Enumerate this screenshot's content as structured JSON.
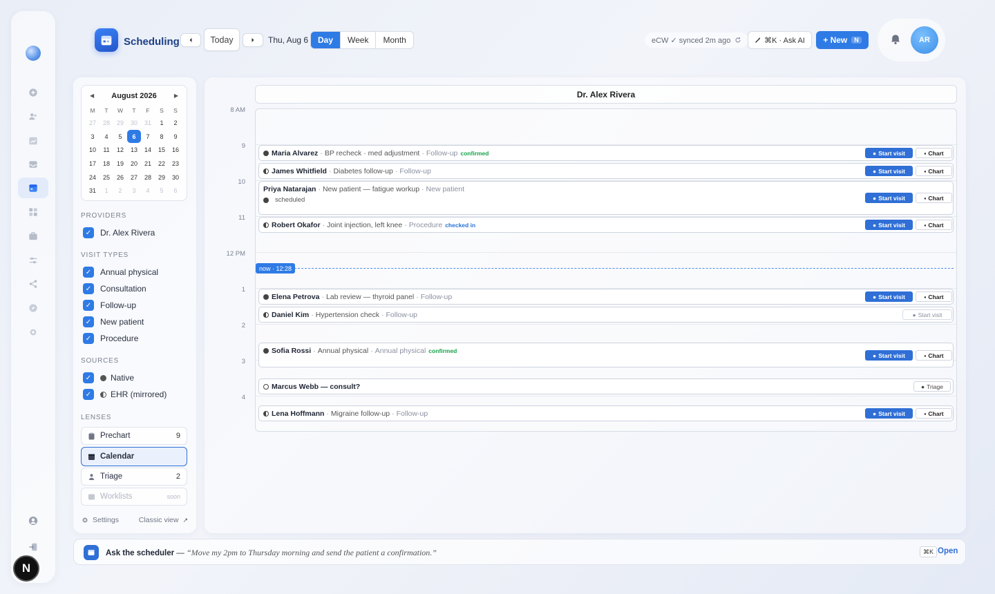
{
  "header": {
    "app_title": "Scheduling",
    "today_label": "Today",
    "date_label": "Thu, Aug 6",
    "views": [
      "Day",
      "Week",
      "Month"
    ],
    "active_view": "Day",
    "sync_status": "eCW ✓ synced 2m ago",
    "ask_ai_label": "⌘K · Ask AI",
    "new_label": "+ New",
    "new_shortcut": "N",
    "avatar_initials": "AR"
  },
  "rail": {
    "icons": [
      "plus-icon",
      "users-icon",
      "chart-icon",
      "inbox-icon",
      "calendar-icon",
      "grid-icon",
      "briefcase-icon",
      "sliders-icon",
      "share-icon",
      "compass-icon",
      "settings-icon",
      "user-icon",
      "logout-icon"
    ],
    "active": "calendar-icon",
    "badge": "N"
  },
  "mini_calendar": {
    "month_label": "August 2026",
    "weekdays": [
      "M",
      "T",
      "W",
      "T",
      "F",
      "S",
      "S"
    ],
    "weeks": [
      [
        "27",
        "28",
        "29",
        "30",
        "31",
        "1",
        "2"
      ],
      [
        "3",
        "4",
        "5",
        "6",
        "7",
        "8",
        "9"
      ],
      [
        "10",
        "11",
        "12",
        "13",
        "14",
        "15",
        "16"
      ],
      [
        "17",
        "18",
        "19",
        "20",
        "21",
        "22",
        "23"
      ],
      [
        "24",
        "25",
        "26",
        "27",
        "28",
        "29",
        "30"
      ],
      [
        "31",
        "1",
        "2",
        "3",
        "4",
        "5",
        "6"
      ]
    ],
    "selected_day": "6"
  },
  "providers": {
    "title": "PROVIDERS",
    "items": [
      "Dr. Alex Rivera"
    ]
  },
  "visit_types": {
    "title": "VISIT TYPES",
    "items": [
      "Annual physical",
      "Consultation",
      "Follow-up",
      "New patient",
      "Procedure"
    ]
  },
  "sources": {
    "title": "SOURCES",
    "items": [
      "Native",
      "EHR (mirrored)"
    ]
  },
  "lenses": {
    "title": "LENSES",
    "items": [
      {
        "label": "Prechart",
        "count": "9"
      },
      {
        "label": "Calendar",
        "count": ""
      },
      {
        "label": "Triage",
        "count": "2"
      },
      {
        "label": "Worklists",
        "count": "soon"
      }
    ]
  },
  "footer": {
    "settings_label": "Settings",
    "classic_label": "Classic view"
  },
  "calendar": {
    "provider_name": "Dr. Alex Rivera",
    "hours": [
      "8 AM",
      "9",
      "10",
      "11",
      "12 PM",
      "1",
      "2",
      "3",
      "4"
    ],
    "now_label": "now · 12:28",
    "start_visit_label": "Start visit",
    "chart_label": "Chart",
    "triage_label": "Triage",
    "appointments": [
      {
        "name": "Maria Alvarez",
        "reason": "BP recheck · med adjustment",
        "type": "Follow-up",
        "status": "confirmed"
      },
      {
        "name": "James Whitfield",
        "reason": "Diabetes follow-up",
        "type": "Follow-up",
        "status": ""
      },
      {
        "name": "Priya Natarajan",
        "reason": "New patient — fatigue workup",
        "type": "New patient",
        "status": "scheduled"
      },
      {
        "name": "Robert Okafor",
        "reason": "Joint injection, left knee",
        "type": "Procedure",
        "status": "checked in"
      },
      {
        "name": "Elena Petrova",
        "reason": "Lab review — thyroid panel",
        "type": "Follow-up",
        "status": ""
      },
      {
        "name": "Daniel Kim",
        "reason": "Hypertension check",
        "type": "Follow-up",
        "status": ""
      },
      {
        "name": "Sofia Rossi",
        "reason": "Annual physical",
        "type": "Annual physical",
        "status": "confirmed"
      },
      {
        "name": "Marcus Webb — consult?",
        "reason": "",
        "type": "",
        "status": ""
      },
      {
        "name": "Lena Hoffmann",
        "reason": "Migraine follow-up",
        "type": "Follow-up",
        "status": ""
      }
    ]
  },
  "ask_bar": {
    "label": "Ask the scheduler",
    "dash": "—",
    "example": "“Move my 2pm to Thursday morning and send the patient a confirmation.”",
    "shortcut": "⌘K",
    "open_label": "Open"
  },
  "colors": {
    "accent": "#2f7be5",
    "confirmed": "#17a34a",
    "checked_in": "#2674d6"
  }
}
